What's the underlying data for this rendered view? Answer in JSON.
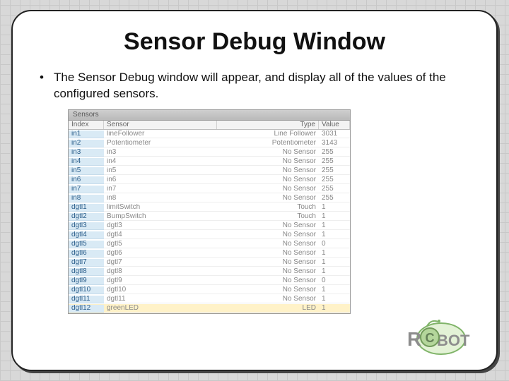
{
  "title": "Sensor Debug Window",
  "bullet_text": "The Sensor Debug window will appear, and display all of the values of the configured sensors.",
  "panel": {
    "caption": "Sensors",
    "headers": {
      "index": "Index",
      "sensor": "Sensor",
      "type": "Type",
      "value": "Value"
    },
    "rows": [
      {
        "idx": "in1",
        "sensor": "lineFollower",
        "type": "Line Follower",
        "value": "3031"
      },
      {
        "idx": "in2",
        "sensor": "Potentiometer",
        "type": "Potentiometer",
        "value": "3143"
      },
      {
        "idx": "in3",
        "sensor": "in3",
        "type": "No Sensor",
        "value": "255"
      },
      {
        "idx": "in4",
        "sensor": "in4",
        "type": "No Sensor",
        "value": "255"
      },
      {
        "idx": "in5",
        "sensor": "in5",
        "type": "No Sensor",
        "value": "255"
      },
      {
        "idx": "in6",
        "sensor": "in6",
        "type": "No Sensor",
        "value": "255"
      },
      {
        "idx": "in7",
        "sensor": "in7",
        "type": "No Sensor",
        "value": "255"
      },
      {
        "idx": "in8",
        "sensor": "in8",
        "type": "No Sensor",
        "value": "255"
      },
      {
        "idx": "dgtl1",
        "sensor": "limitSwitch",
        "type": "Touch",
        "value": "1"
      },
      {
        "idx": "dgtl2",
        "sensor": "BumpSwitch",
        "type": "Touch",
        "value": "1"
      },
      {
        "idx": "dgtl3",
        "sensor": "dgtl3",
        "type": "No Sensor",
        "value": "1"
      },
      {
        "idx": "dgtl4",
        "sensor": "dgtl4",
        "type": "No Sensor",
        "value": "1"
      },
      {
        "idx": "dgtl5",
        "sensor": "dgtl5",
        "type": "No Sensor",
        "value": "0"
      },
      {
        "idx": "dgtl6",
        "sensor": "dgtl6",
        "type": "No Sensor",
        "value": "1"
      },
      {
        "idx": "dgtl7",
        "sensor": "dgtl7",
        "type": "No Sensor",
        "value": "1"
      },
      {
        "idx": "dgtl8",
        "sensor": "dgtl8",
        "type": "No Sensor",
        "value": "1"
      },
      {
        "idx": "dgtl9",
        "sensor": "dgtl9",
        "type": "No Sensor",
        "value": "0"
      },
      {
        "idx": "dgtl10",
        "sensor": "dgtl10",
        "type": "No Sensor",
        "value": "1"
      },
      {
        "idx": "dgtl11",
        "sensor": "dgtl11",
        "type": "No Sensor",
        "value": "1"
      },
      {
        "idx": "dgtl12",
        "sensor": "greenLED",
        "type": "LED",
        "value": "1"
      }
    ]
  },
  "logo": {
    "text_left": "R",
    "text_right": "BOT",
    "subtext": "C"
  }
}
